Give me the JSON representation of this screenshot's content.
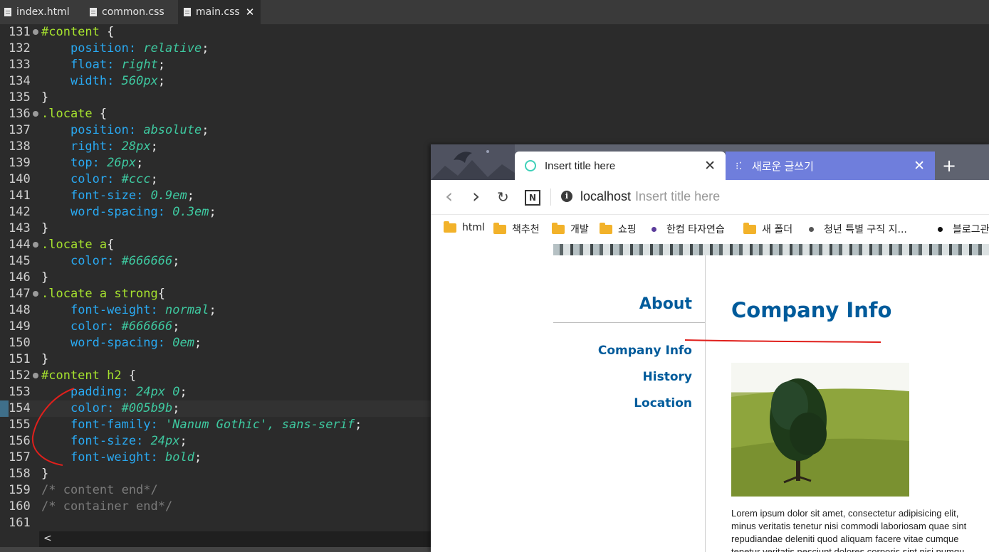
{
  "editor": {
    "tabs": [
      {
        "label": "index.html"
      },
      {
        "label": "common.css"
      },
      {
        "label": "main.css",
        "close": "✕"
      }
    ],
    "lines": [
      {
        "n": "131",
        "fold": true,
        "tokens": [
          [
            "sel",
            "#content"
          ],
          [
            "pun",
            " {"
          ]
        ]
      },
      {
        "n": "132",
        "tokens": [
          [
            "pun",
            "    "
          ],
          [
            "prop",
            "position:"
          ],
          [
            "pun",
            " "
          ],
          [
            "val",
            "relative"
          ],
          [
            "pun",
            ";"
          ]
        ]
      },
      {
        "n": "133",
        "tokens": [
          [
            "pun",
            "    "
          ],
          [
            "prop",
            "float:"
          ],
          [
            "pun",
            " "
          ],
          [
            "val",
            "right"
          ],
          [
            "pun",
            ";"
          ]
        ]
      },
      {
        "n": "134",
        "tokens": [
          [
            "pun",
            "    "
          ],
          [
            "prop",
            "width:"
          ],
          [
            "pun",
            " "
          ],
          [
            "val",
            "560px"
          ],
          [
            "pun",
            ";"
          ]
        ]
      },
      {
        "n": "135",
        "tokens": [
          [
            "pun",
            "}"
          ]
        ]
      },
      {
        "n": "136",
        "fold": true,
        "tokens": [
          [
            "sel",
            ".locate"
          ],
          [
            "pun",
            " {"
          ]
        ]
      },
      {
        "n": "137",
        "tokens": [
          [
            "pun",
            "    "
          ],
          [
            "prop",
            "position:"
          ],
          [
            "pun",
            " "
          ],
          [
            "val",
            "absolute"
          ],
          [
            "pun",
            ";"
          ]
        ]
      },
      {
        "n": "138",
        "tokens": [
          [
            "pun",
            "    "
          ],
          [
            "prop",
            "right:"
          ],
          [
            "pun",
            " "
          ],
          [
            "val",
            "28px"
          ],
          [
            "pun",
            ";"
          ]
        ]
      },
      {
        "n": "139",
        "tokens": [
          [
            "pun",
            "    "
          ],
          [
            "prop",
            "top:"
          ],
          [
            "pun",
            " "
          ],
          [
            "val",
            "26px"
          ],
          [
            "pun",
            ";"
          ]
        ]
      },
      {
        "n": "140",
        "tokens": [
          [
            "pun",
            "    "
          ],
          [
            "prop",
            "color:"
          ],
          [
            "pun",
            " "
          ],
          [
            "val",
            "#ccc"
          ],
          [
            "pun",
            ";"
          ]
        ]
      },
      {
        "n": "141",
        "tokens": [
          [
            "pun",
            "    "
          ],
          [
            "prop",
            "font-size:"
          ],
          [
            "pun",
            " "
          ],
          [
            "val",
            "0.9em"
          ],
          [
            "pun",
            ";"
          ]
        ]
      },
      {
        "n": "142",
        "tokens": [
          [
            "pun",
            "    "
          ],
          [
            "prop",
            "word-spacing:"
          ],
          [
            "pun",
            " "
          ],
          [
            "val",
            "0.3em"
          ],
          [
            "pun",
            ";"
          ]
        ]
      },
      {
        "n": "143",
        "tokens": [
          [
            "pun",
            "}"
          ]
        ]
      },
      {
        "n": "144",
        "fold": true,
        "tokens": [
          [
            "sel",
            ".locate a"
          ],
          [
            "pun",
            "{"
          ]
        ]
      },
      {
        "n": "145",
        "tokens": [
          [
            "pun",
            "    "
          ],
          [
            "prop",
            "color:"
          ],
          [
            "pun",
            " "
          ],
          [
            "val",
            "#666666"
          ],
          [
            "pun",
            ";"
          ]
        ]
      },
      {
        "n": "146",
        "tokens": [
          [
            "pun",
            "}"
          ]
        ]
      },
      {
        "n": "147",
        "fold": true,
        "tokens": [
          [
            "sel",
            ".locate a strong"
          ],
          [
            "pun",
            "{"
          ]
        ]
      },
      {
        "n": "148",
        "tokens": [
          [
            "pun",
            "    "
          ],
          [
            "prop",
            "font-weight:"
          ],
          [
            "pun",
            " "
          ],
          [
            "val",
            "normal"
          ],
          [
            "pun",
            ";"
          ]
        ]
      },
      {
        "n": "149",
        "tokens": [
          [
            "pun",
            "    "
          ],
          [
            "prop",
            "color:"
          ],
          [
            "pun",
            " "
          ],
          [
            "val",
            "#666666"
          ],
          [
            "pun",
            ";"
          ]
        ]
      },
      {
        "n": "150",
        "tokens": [
          [
            "pun",
            "    "
          ],
          [
            "prop",
            "word-spacing:"
          ],
          [
            "pun",
            " "
          ],
          [
            "val",
            "0em"
          ],
          [
            "pun",
            ";"
          ]
        ]
      },
      {
        "n": "151",
        "tokens": [
          [
            "pun",
            "}"
          ]
        ]
      },
      {
        "n": "152",
        "fold": true,
        "tokens": [
          [
            "sel",
            "#content h2"
          ],
          [
            "pun",
            " {"
          ]
        ]
      },
      {
        "n": "153",
        "tokens": [
          [
            "pun",
            "    "
          ],
          [
            "prop",
            "padding:"
          ],
          [
            "pun",
            " "
          ],
          [
            "val",
            "24px 0"
          ],
          [
            "pun",
            ";"
          ]
        ]
      },
      {
        "n": "154",
        "current": true,
        "tokens": [
          [
            "pun",
            "    "
          ],
          [
            "prop",
            "color:"
          ],
          [
            "pun",
            " "
          ],
          [
            "val",
            "#005b9b"
          ],
          [
            "pun",
            ";"
          ]
        ]
      },
      {
        "n": "155",
        "tokens": [
          [
            "pun",
            "    "
          ],
          [
            "prop",
            "font-family:"
          ],
          [
            "pun",
            " "
          ],
          [
            "val",
            "'Nanum Gothic', sans-serif"
          ],
          [
            "pun",
            ";"
          ]
        ]
      },
      {
        "n": "156",
        "tokens": [
          [
            "pun",
            "    "
          ],
          [
            "prop",
            "font-size:"
          ],
          [
            "pun",
            " "
          ],
          [
            "val",
            "24px"
          ],
          [
            "pun",
            ";"
          ]
        ]
      },
      {
        "n": "157",
        "tokens": [
          [
            "pun",
            "    "
          ],
          [
            "prop",
            "font-weight:"
          ],
          [
            "pun",
            " "
          ],
          [
            "val",
            "bold"
          ],
          [
            "pun",
            ";"
          ]
        ]
      },
      {
        "n": "158",
        "tokens": [
          [
            "pun",
            "}"
          ]
        ]
      },
      {
        "n": "159",
        "tokens": [
          [
            "cmt",
            "/* content end*/"
          ]
        ]
      },
      {
        "n": "160",
        "tokens": [
          [
            "cmt",
            "/* container end*/"
          ]
        ]
      },
      {
        "n": "161",
        "tokens": []
      }
    ],
    "scroll_arrow": "<"
  },
  "browser": {
    "tabs": [
      {
        "title": "Insert title here",
        "close": "✕"
      },
      {
        "title": "새로운 글쓰기",
        "close": "✕"
      }
    ],
    "new_tab": "+",
    "toolbar": {
      "back": "‹",
      "forward": "›",
      "reload": "↻",
      "ext": "N",
      "info": "i"
    },
    "url": {
      "host": "localhost",
      "title": "Insert title here"
    },
    "bookmarks": [
      {
        "type": "folder",
        "label": "html"
      },
      {
        "type": "folder",
        "label": "책추천"
      },
      {
        "type": "folder",
        "label": "개발"
      },
      {
        "type": "folder",
        "label": "쇼핑"
      },
      {
        "type": "dot",
        "color": "#5b3c9b",
        "label": "한컴 타자연습"
      },
      {
        "type": "folder",
        "label": "새 폴더"
      },
      {
        "type": "dot",
        "color": "#555555",
        "label": "청년 특별 구직 지..."
      },
      {
        "type": "dot",
        "color": "#111111",
        "label": "블로그관"
      }
    ],
    "page": {
      "lnb_title": "About",
      "lnb_items": [
        "Company Info",
        "History",
        "Location"
      ],
      "heading": "Company Info",
      "body_lines": [
        "Lorem ipsum dolor sit amet, consectetur adipisicing elit,",
        "minus veritatis tenetur nisi commodi laboriosam quae sint",
        "repudiandae deleniti quod aliquam facere vitae cumque",
        "tenetur veritatis nesciunt dolores corporis sint nisi numqu"
      ]
    }
  },
  "colors": {
    "heading_blue": "#005b9b",
    "selector_green": "#a6e22e",
    "property_blue": "#29a9f2",
    "value_teal": "#3ec9a0",
    "annotation_red": "#e0201c"
  }
}
